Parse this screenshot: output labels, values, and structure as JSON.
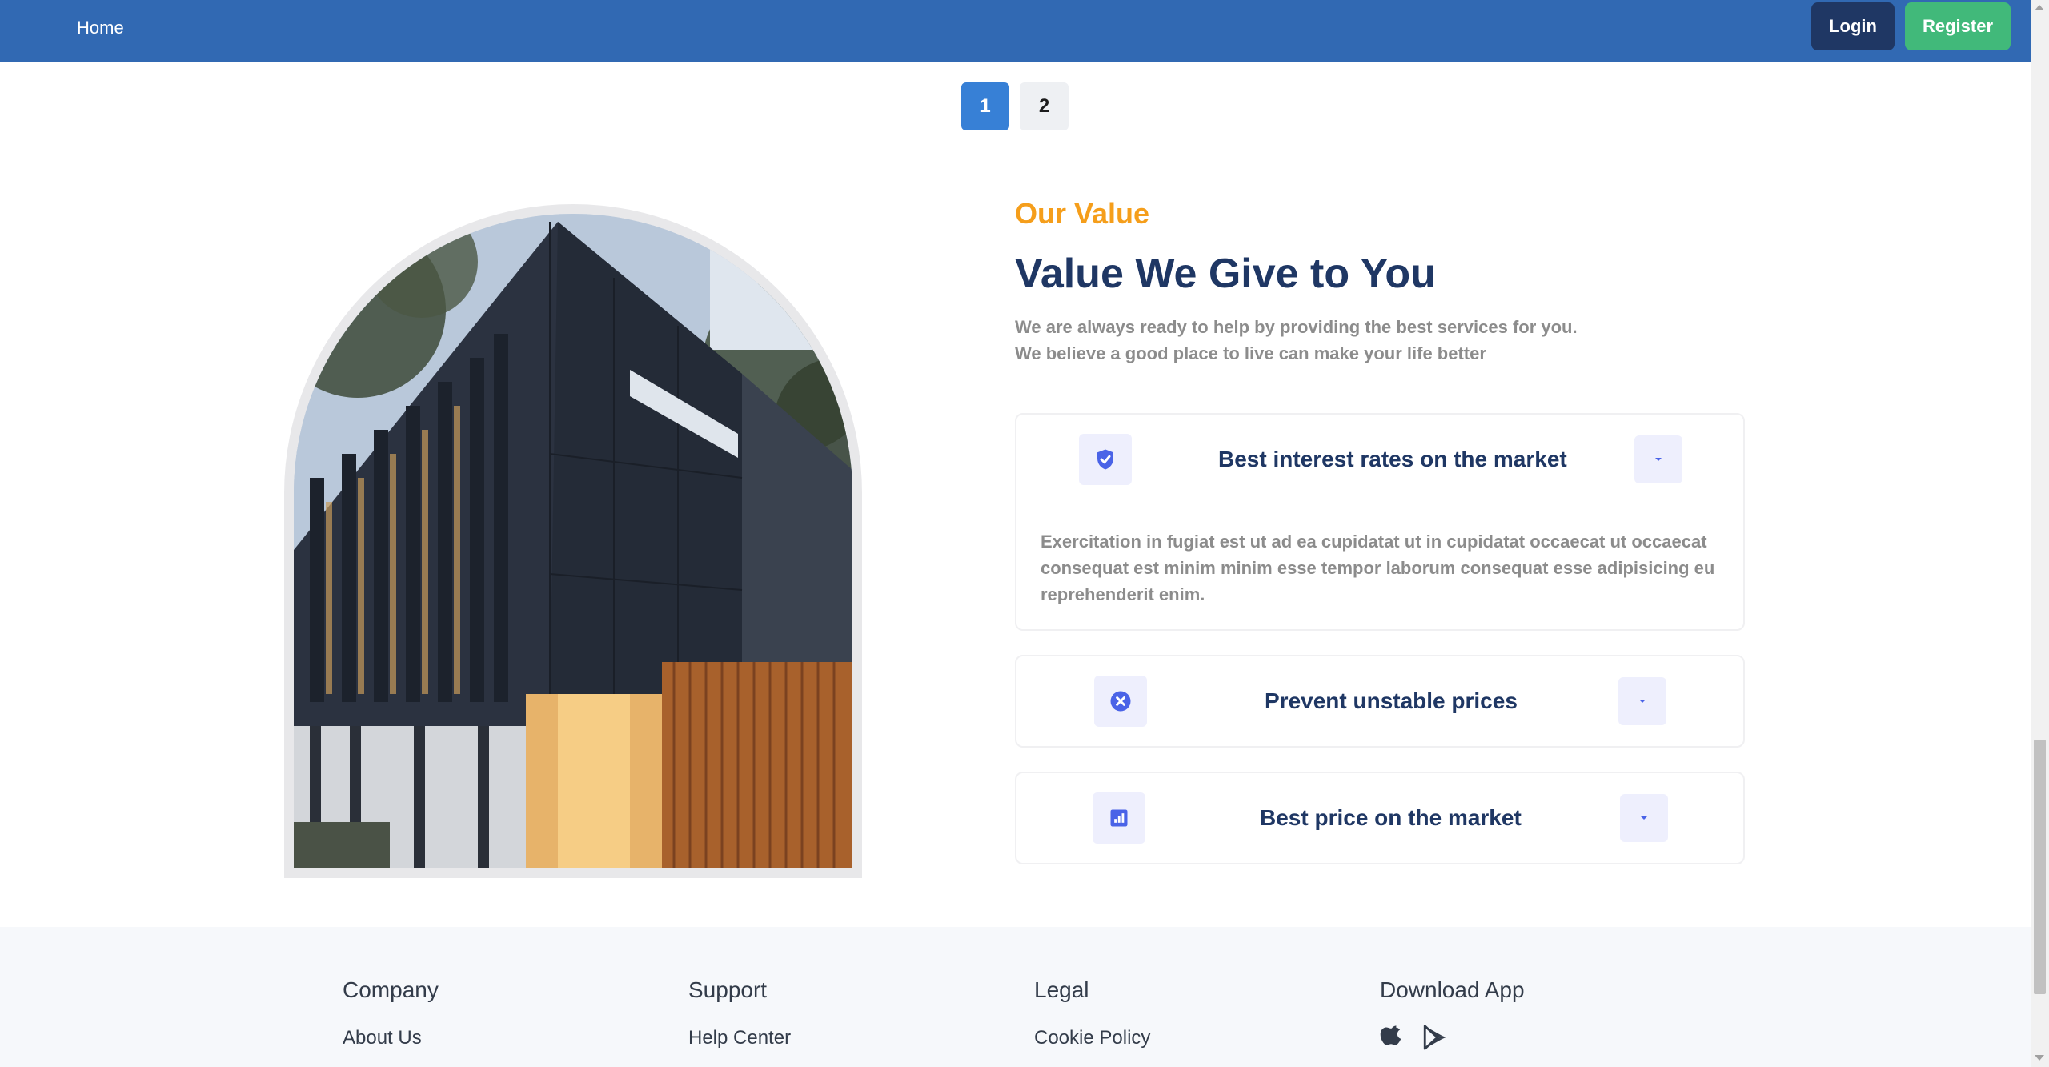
{
  "navbar": {
    "home_label": "Home",
    "login_label": "Login",
    "register_label": "Register",
    "brand_color": "#3169b3"
  },
  "pagination": {
    "pages": [
      "1",
      "2"
    ],
    "current": "1"
  },
  "value_section": {
    "eyebrow": "Our Value",
    "heading": "Value We Give to You",
    "desc_line1": "We are always ready to help by providing the best services for you.",
    "desc_line2": "We believe a good place to live can make your life better",
    "accordion": [
      {
        "title": "Best interest rates on the market",
        "icon": "shield-check-icon",
        "expanded": true,
        "body": "Exercitation in fugiat est ut ad ea cupidatat ut in cupidatat occaecat ut occaecat consequat est minim minim esse tempor laborum consequat esse adipisicing eu reprehenderit enim."
      },
      {
        "title": "Prevent unstable prices",
        "icon": "x-circle-icon",
        "expanded": false
      },
      {
        "title": "Best price on the market",
        "icon": "bar-chart-icon",
        "expanded": false
      }
    ]
  },
  "footer": {
    "columns": [
      {
        "heading": "Company",
        "links": [
          "About Us"
        ]
      },
      {
        "heading": "Support",
        "links": [
          "Help Center"
        ]
      },
      {
        "heading": "Legal",
        "links": [
          "Cookie Policy"
        ]
      },
      {
        "heading": "Download App",
        "icons": [
          "apple-icon",
          "google-play-icon"
        ]
      }
    ]
  },
  "colors": {
    "accent_orange": "#f59e1b",
    "heading_navy": "#1f3764",
    "register_green": "#41b97a",
    "icon_blue": "#4a63e7"
  }
}
